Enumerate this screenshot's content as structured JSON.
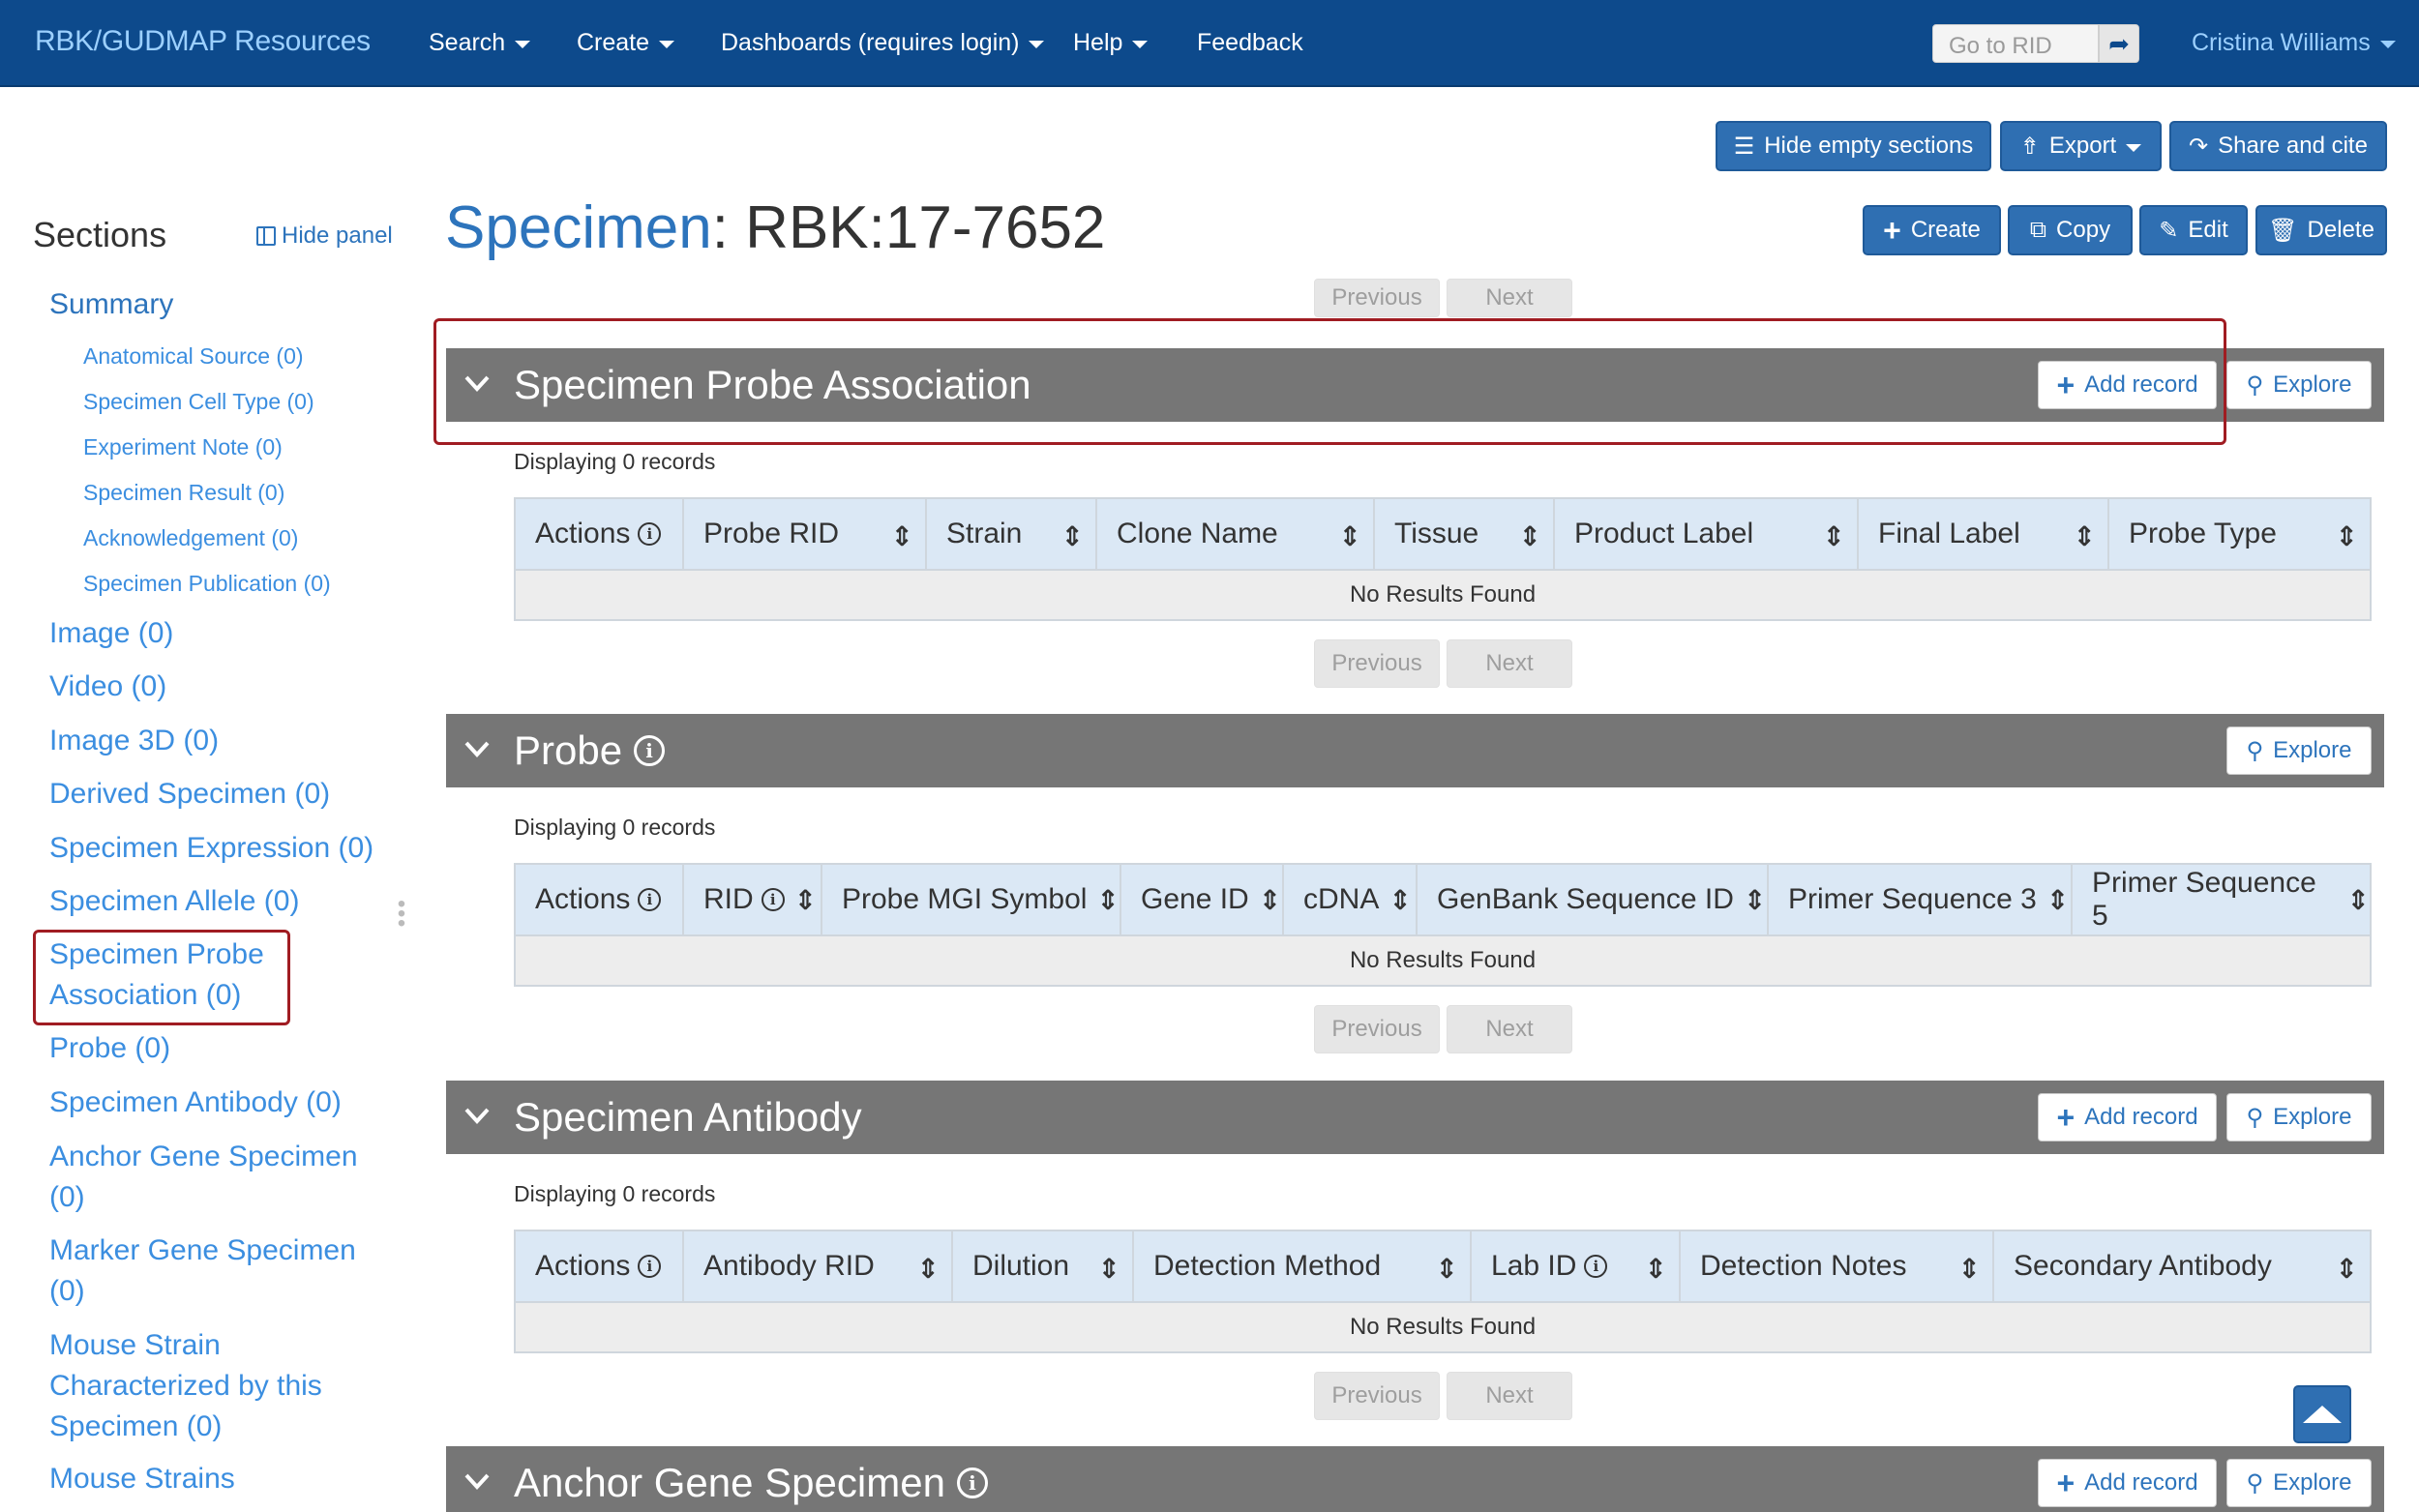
{
  "navbar": {
    "brand": "RBK/GUDMAP Resources",
    "items": [
      {
        "label": "Search"
      },
      {
        "label": "Create"
      },
      {
        "label": "Dashboards (requires login)"
      },
      {
        "label": "Help"
      },
      {
        "label": "Feedback"
      }
    ],
    "rid_placeholder": "Go to RID",
    "user": "Cristina Williams"
  },
  "toolbar": {
    "hide_empty": "Hide empty sections",
    "export": "Export",
    "share": "Share and cite",
    "create": "Create",
    "copy": "Copy",
    "edit": "Edit",
    "delete": "Delete"
  },
  "sidebar": {
    "title": "Sections",
    "hide_panel": "Hide panel",
    "summary": "Summary",
    "sub_items": [
      "Anatomical Source (0)",
      "Specimen Cell Type (0)",
      "Experiment Note (0)",
      "Specimen Result (0)",
      "Acknowledgement (0)",
      "Specimen Publication (0)"
    ],
    "items": [
      {
        "lines": [
          "Image (0)"
        ]
      },
      {
        "lines": [
          "Video (0)"
        ]
      },
      {
        "lines": [
          "Image 3D (0)"
        ]
      },
      {
        "lines": [
          "Derived Specimen (0)"
        ]
      },
      {
        "lines": [
          "Specimen Expression (0)"
        ]
      },
      {
        "lines": [
          "Specimen Allele (0)"
        ]
      },
      {
        "lines": [
          "Specimen Probe",
          "Association (0)"
        ]
      },
      {
        "lines": [
          "Probe (0)"
        ]
      },
      {
        "lines": [
          "Specimen Antibody (0)"
        ]
      },
      {
        "lines": [
          "Anchor Gene Specimen",
          "(0)"
        ]
      },
      {
        "lines": [
          "Marker Gene Specimen",
          "(0)"
        ]
      },
      {
        "lines": [
          "Mouse Strain",
          "Characterized by this",
          "Specimen (0)"
        ]
      },
      {
        "lines": [
          "Mouse Strains"
        ]
      }
    ]
  },
  "page": {
    "entity": "Specimen",
    "colon": ":",
    "record_id": "RBK:17-7652"
  },
  "pager": {
    "previous": "Previous",
    "next": "Next"
  },
  "common": {
    "add_record": "Add record",
    "explore": "Explore",
    "displaying": "Displaying 0 records",
    "no_results": "No Results Found"
  },
  "sections": [
    {
      "title": "Specimen Probe Association",
      "columns": [
        "Actions",
        "Probe RID",
        "Strain",
        "Clone Name",
        "Tissue",
        "Product Label",
        "Final Label",
        "Probe Type"
      ]
    },
    {
      "title": "Probe",
      "columns": [
        "Actions",
        "RID",
        "Probe MGI Symbol",
        "Gene ID",
        "cDNA",
        "GenBank Sequence ID",
        "Primer Sequence 3",
        "Primer Sequence 5"
      ]
    },
    {
      "title": "Specimen Antibody",
      "columns": [
        "Actions",
        "Antibody RID",
        "Dilution",
        "Detection Method",
        "Lab ID",
        "Detection Notes",
        "Secondary Antibody"
      ]
    },
    {
      "title": "Anchor Gene Specimen",
      "columns": []
    }
  ],
  "colors": {
    "navbar": "#0d4a8c",
    "link": "#3b8ee0",
    "section_bar": "#767676",
    "button_primary": "#2f6fb2",
    "highlight": "#a01c22",
    "table_header": "#dbe8f5"
  }
}
